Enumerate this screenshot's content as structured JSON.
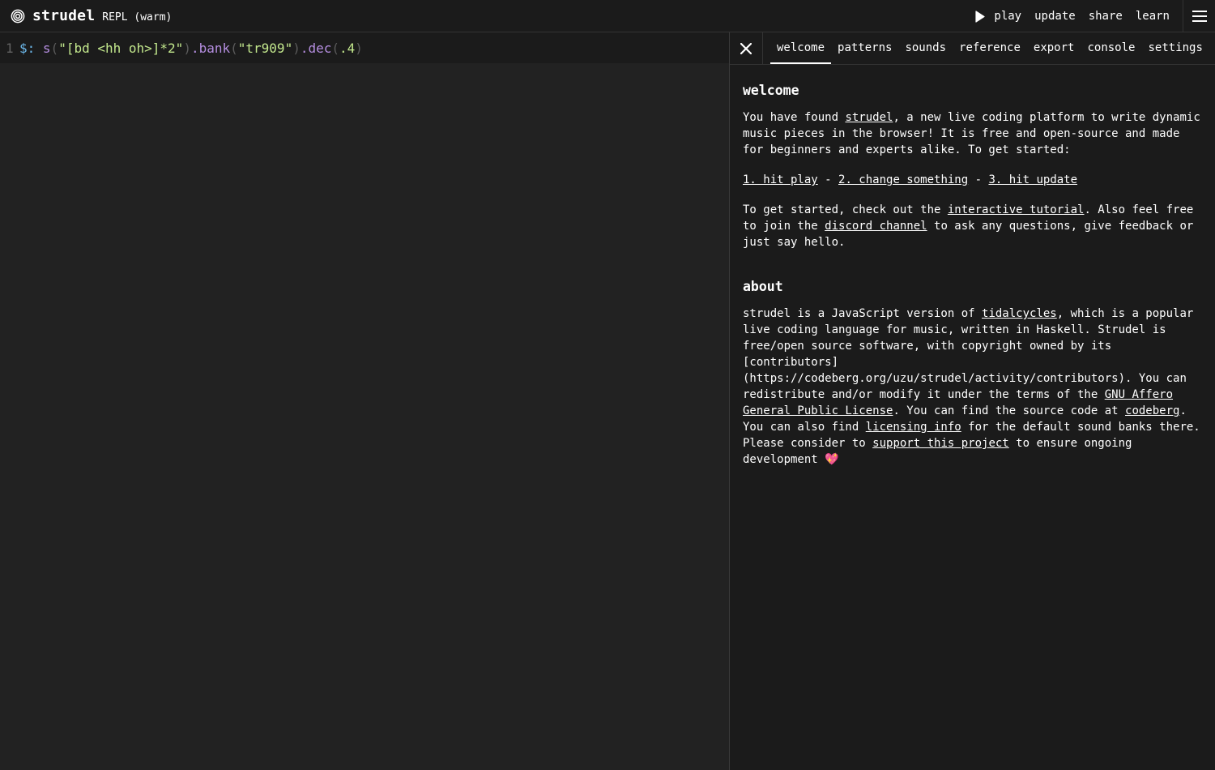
{
  "header": {
    "app_name": "strudel",
    "mode": "REPL (warm)",
    "nav": {
      "play": "play",
      "update": "update",
      "share": "share",
      "learn": "learn"
    }
  },
  "editor": {
    "line_number": "1",
    "tokens": {
      "label": "$:",
      "s_fn": "s",
      "open1": "(",
      "str1": "\"[bd <hh oh>]*2\"",
      "close1": ")",
      "bank_fn": ".bank",
      "open2": "(",
      "str2": "\"tr909\"",
      "close2": ")",
      "dec_fn": ".dec",
      "open3": "(",
      "num": ".4",
      "close3": ")"
    }
  },
  "panel": {
    "tabs": [
      "welcome",
      "patterns",
      "sounds",
      "reference",
      "export",
      "console",
      "settings"
    ],
    "active_tab": "welcome",
    "welcome": {
      "title": "welcome",
      "intro_pre": "You have found ",
      "intro_link": "strudel",
      "intro_post": ", a new live coding platform to write dynamic music pieces in the browser! It is free and open-source and made for beginners and experts alike. To get started:",
      "step1": "1. hit play",
      "sep1": " - ",
      "step2": "2. change something",
      "sep2": " - ",
      "step3": "3. hit update",
      "p3_a": "To get started, check out the ",
      "p3_link1": "interactive tutorial",
      "p3_b": ". Also feel free to join the ",
      "p3_link2": "discord channel",
      "p3_c": " to ask any questions, give feedback or just say hello."
    },
    "about": {
      "title": "about",
      "a1": "strudel is a JavaScript version of ",
      "link_tidal": "tidalcycles",
      "a2": ", which is a popular live coding language for music, written in Haskell. Strudel is free/open source software, with copyright owned by its [contributors](https://codeberg.org/uzu/strudel/activity/contributors). You can redistribute and/or modify it under the terms of the ",
      "link_gnu": "GNU Affero General Public License",
      "a3": ". You can find the source code at ",
      "link_codeberg": "codeberg",
      "a4": ". You can also find ",
      "link_licensing": "licensing info",
      "a5": " for the default sound banks there. Please consider to ",
      "link_support": "support this project",
      "a6": " to ensure ongoing development ",
      "emoji": "💖"
    }
  },
  "colors": {
    "background": "#222222",
    "panel": "#1b1b1b",
    "string": "#c3e88d",
    "function": "#b58ee0",
    "label": "#6bb6e8"
  },
  "icons": {
    "logo": "strudel-spiral-icon",
    "play": "play-icon",
    "menu": "hamburger-menu-icon",
    "close": "close-icon"
  }
}
